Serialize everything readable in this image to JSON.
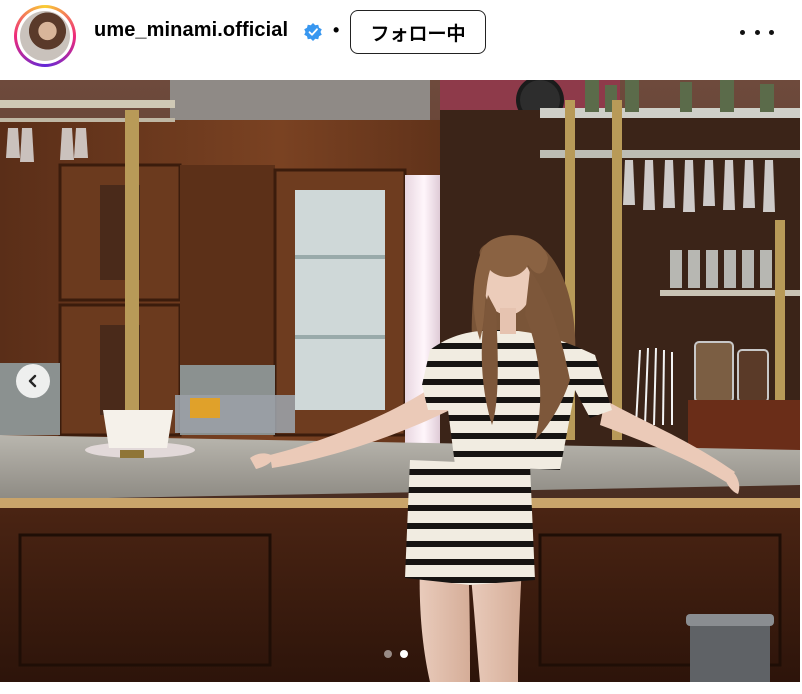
{
  "post": {
    "username": "ume_minami.official",
    "separator": "•",
    "follow_label": "フォロー中",
    "more_icon": "more-horizontal-icon",
    "verified_icon": "verified-badge-icon",
    "avatar": "profile-avatar"
  },
  "carousel": {
    "prev_icon": "chevron-left-icon",
    "slide_count": 2,
    "active_slide": 2
  },
  "colors": {
    "verified": "#3897f0",
    "ring_start": "#f9ce34",
    "ring_mid": "#ee2a7b",
    "ring_end": "#6228d7"
  }
}
